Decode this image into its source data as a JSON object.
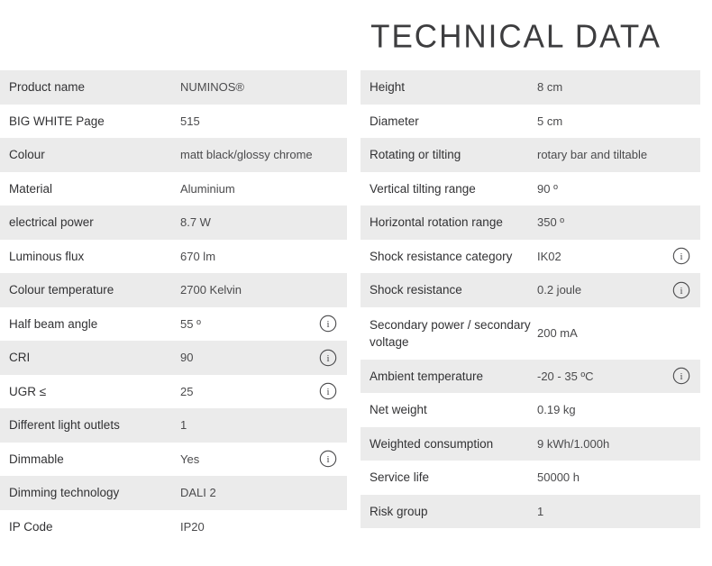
{
  "header": {
    "title": "TECHNICAL DATA"
  },
  "icons": {
    "info": "info-icon",
    "info_glyph": "i"
  },
  "colors": {
    "row_shaded": "#ebebeb",
    "row_plain": "#ffffff",
    "label_text": "#323234",
    "value_text": "#4b4b4d",
    "title_text": "#3d3d3f"
  },
  "left_table": {
    "rows": [
      {
        "label": "Product name",
        "value": "NUMINOS®",
        "info": false,
        "shaded": true
      },
      {
        "label": "BIG WHITE Page",
        "value": "515",
        "info": false,
        "shaded": false
      },
      {
        "label": "Colour",
        "value": "matt black/glossy chrome",
        "info": false,
        "shaded": true
      },
      {
        "label": "Material",
        "value": "Aluminium",
        "info": false,
        "shaded": false
      },
      {
        "label": "electrical power",
        "value": "8.7 W",
        "info": false,
        "shaded": true
      },
      {
        "label": "Luminous flux",
        "value": "670 lm",
        "info": false,
        "shaded": false
      },
      {
        "label": "Colour temperature",
        "value": "2700 Kelvin",
        "info": false,
        "shaded": true
      },
      {
        "label": "Half beam angle",
        "value": "55 º",
        "info": true,
        "shaded": false
      },
      {
        "label": "CRI",
        "value": "90",
        "info": true,
        "shaded": true
      },
      {
        "label": "UGR ≤",
        "value": "25",
        "info": true,
        "shaded": false
      },
      {
        "label": "Different light outlets",
        "value": "1",
        "info": false,
        "shaded": true
      },
      {
        "label": "Dimmable",
        "value": "Yes",
        "info": true,
        "shaded": false
      },
      {
        "label": "Dimming technology",
        "value": "DALI 2",
        "info": false,
        "shaded": true
      },
      {
        "label": "IP Code",
        "value": "IP20",
        "info": false,
        "shaded": false
      }
    ]
  },
  "right_table": {
    "rows": [
      {
        "label": "Height",
        "value": "8 cm",
        "info": false,
        "shaded": true,
        "tall": false
      },
      {
        "label": "Diameter",
        "value": "5 cm",
        "info": false,
        "shaded": false,
        "tall": false
      },
      {
        "label": "Rotating or tilting",
        "value": "rotary bar and tiltable",
        "info": false,
        "shaded": true,
        "tall": false
      },
      {
        "label": "Vertical tilting range",
        "value": "90 º",
        "info": false,
        "shaded": false,
        "tall": false
      },
      {
        "label": "Horizontal rotation range",
        "value": "350 º",
        "info": false,
        "shaded": true,
        "tall": false
      },
      {
        "label": "Shock resistance category",
        "value": "IK02",
        "info": true,
        "shaded": false,
        "tall": false
      },
      {
        "label": "Shock resistance",
        "value": "0.2 joule",
        "info": true,
        "shaded": true,
        "tall": false
      },
      {
        "label": "Secondary power / secondary voltage",
        "value": "200 mA",
        "info": false,
        "shaded": false,
        "tall": true
      },
      {
        "label": "Ambient temperature",
        "value": "-20 - 35 ºC",
        "info": true,
        "shaded": true,
        "tall": false
      },
      {
        "label": "Net weight",
        "value": "0.19 kg",
        "info": false,
        "shaded": false,
        "tall": false
      },
      {
        "label": "Weighted consumption",
        "value": "9 kWh/1.000h",
        "info": false,
        "shaded": true,
        "tall": false
      },
      {
        "label": "Service life",
        "value": "50000 h",
        "info": false,
        "shaded": false,
        "tall": false
      },
      {
        "label": "Risk group",
        "value": "1",
        "info": false,
        "shaded": true,
        "tall": false
      }
    ]
  }
}
